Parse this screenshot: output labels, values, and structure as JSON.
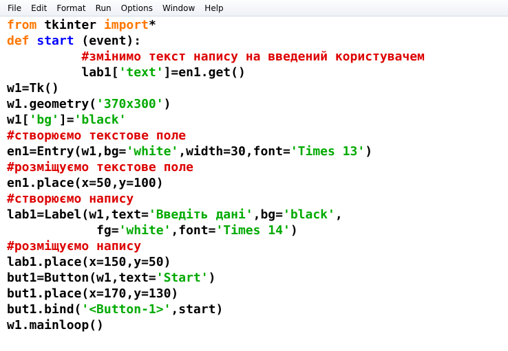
{
  "menu": {
    "items": [
      "File",
      "Edit",
      "Format",
      "Run",
      "Options",
      "Window",
      "Help"
    ]
  },
  "colors": {
    "keyword": "#ff7700",
    "definition": "#0000ff",
    "string": "#00aa00",
    "comment": "#dd0000",
    "default": "#000000"
  },
  "code_lines": [
    [
      {
        "t": "kw",
        "v": "from"
      },
      {
        "t": "df",
        "v": " tkinter "
      },
      {
        "t": "kw",
        "v": "import"
      },
      {
        "t": "df",
        "v": "*"
      }
    ],
    [
      {
        "t": "kw",
        "v": "def"
      },
      {
        "t": "df",
        "v": " "
      },
      {
        "t": "fn",
        "v": "start"
      },
      {
        "t": "df",
        "v": " (event):"
      }
    ],
    [
      {
        "t": "df",
        "v": "          "
      },
      {
        "t": "cm",
        "v": "#змінимо текст напису на введений користувачем"
      }
    ],
    [
      {
        "t": "df",
        "v": "          lab1["
      },
      {
        "t": "str",
        "v": "'text'"
      },
      {
        "t": "df",
        "v": "]=en1.get()"
      }
    ],
    [
      {
        "t": "df",
        "v": "w1=Tk()"
      }
    ],
    [
      {
        "t": "df",
        "v": "w1.geometry("
      },
      {
        "t": "str",
        "v": "'370x300'"
      },
      {
        "t": "df",
        "v": ")"
      }
    ],
    [
      {
        "t": "df",
        "v": "w1["
      },
      {
        "t": "str",
        "v": "'bg'"
      },
      {
        "t": "df",
        "v": "]="
      },
      {
        "t": "str",
        "v": "'black'"
      }
    ],
    [
      {
        "t": "cm",
        "v": "#створюємо текстове поле"
      }
    ],
    [
      {
        "t": "df",
        "v": "en1=Entry(w1,bg="
      },
      {
        "t": "str",
        "v": "'white'"
      },
      {
        "t": "df",
        "v": ",width=30,font="
      },
      {
        "t": "str",
        "v": "'Times 13'"
      },
      {
        "t": "df",
        "v": ")"
      }
    ],
    [
      {
        "t": "cm",
        "v": "#розміщуємо текстове поле"
      }
    ],
    [
      {
        "t": "df",
        "v": "en1.place(x=50,y=100)"
      }
    ],
    [
      {
        "t": "cm",
        "v": "#створюємо напису"
      }
    ],
    [
      {
        "t": "df",
        "v": "lab1=Label(w1,text="
      },
      {
        "t": "str",
        "v": "'Введіть дані'"
      },
      {
        "t": "df",
        "v": ",bg="
      },
      {
        "t": "str",
        "v": "'black'"
      },
      {
        "t": "df",
        "v": ","
      }
    ],
    [
      {
        "t": "df",
        "v": "            fg="
      },
      {
        "t": "str",
        "v": "'white'"
      },
      {
        "t": "df",
        "v": ",font="
      },
      {
        "t": "str",
        "v": "'Times 14'"
      },
      {
        "t": "df",
        "v": ")"
      }
    ],
    [
      {
        "t": "cm",
        "v": "#розміщуємо напису"
      }
    ],
    [
      {
        "t": "df",
        "v": "lab1.place(x=150,y=50)"
      }
    ],
    [
      {
        "t": "df",
        "v": "but1=Button(w1,text="
      },
      {
        "t": "str",
        "v": "'Start'"
      },
      {
        "t": "df",
        "v": ")"
      }
    ],
    [
      {
        "t": "df",
        "v": "but1.place(x=170,y=130)"
      }
    ],
    [
      {
        "t": "df",
        "v": "but1.bind("
      },
      {
        "t": "str",
        "v": "'<Button-1>'"
      },
      {
        "t": "df",
        "v": ",start)"
      }
    ],
    [
      {
        "t": "df",
        "v": "w1.mainloop()"
      }
    ]
  ]
}
